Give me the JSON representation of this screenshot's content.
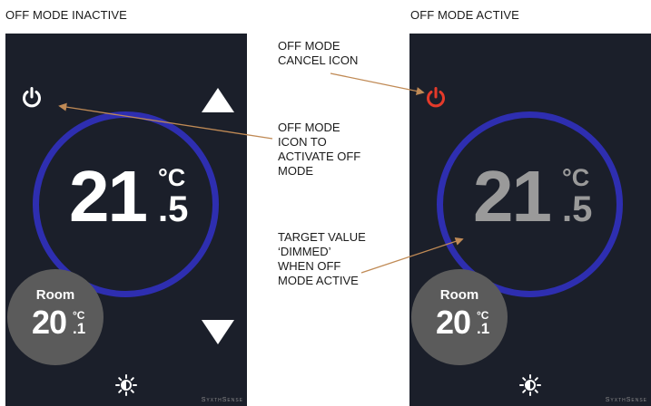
{
  "panels": [
    {
      "heading": "OFF MODE INACTIVE",
      "target_int": "21",
      "target_unit": "°C",
      "target_dec": ".5",
      "target_color": "#ffffff",
      "power_color": "#ffffff",
      "room_label": "Room",
      "room_int": "20",
      "room_unit": "°C",
      "room_dec": ".1",
      "brand": "SyxthSense",
      "icons": [
        "power-icon",
        "arrow-up-icon",
        "arrow-down-icon",
        "brightness-icon"
      ]
    },
    {
      "heading": "OFF MODE ACTIVE",
      "target_int": "21",
      "target_unit": "°C",
      "target_dec": ".5",
      "target_color": "#9a9a9a",
      "power_color": "#e53a2a",
      "room_label": "Room",
      "room_int": "20",
      "room_unit": "°C",
      "room_dec": ".1",
      "brand": "SyxthSense",
      "icons": [
        "power-icon",
        "brightness-icon"
      ]
    }
  ],
  "annotations": {
    "off_mode_icon": "OFF MODE\nICON TO\nACTIVATE OFF\nMODE",
    "cancel_icon": "OFF MODE\nCANCEL ICON",
    "target_dimmed": "TARGET VALUE\n‘DIMMED’\nWHEN OFF\nMODE ACTIVE"
  },
  "colors": {
    "panel_bg": "#1b1f2a",
    "ring": "#2e2eb0",
    "room_bubble": "#5b5b5b",
    "leader_line": "#c08a55"
  }
}
